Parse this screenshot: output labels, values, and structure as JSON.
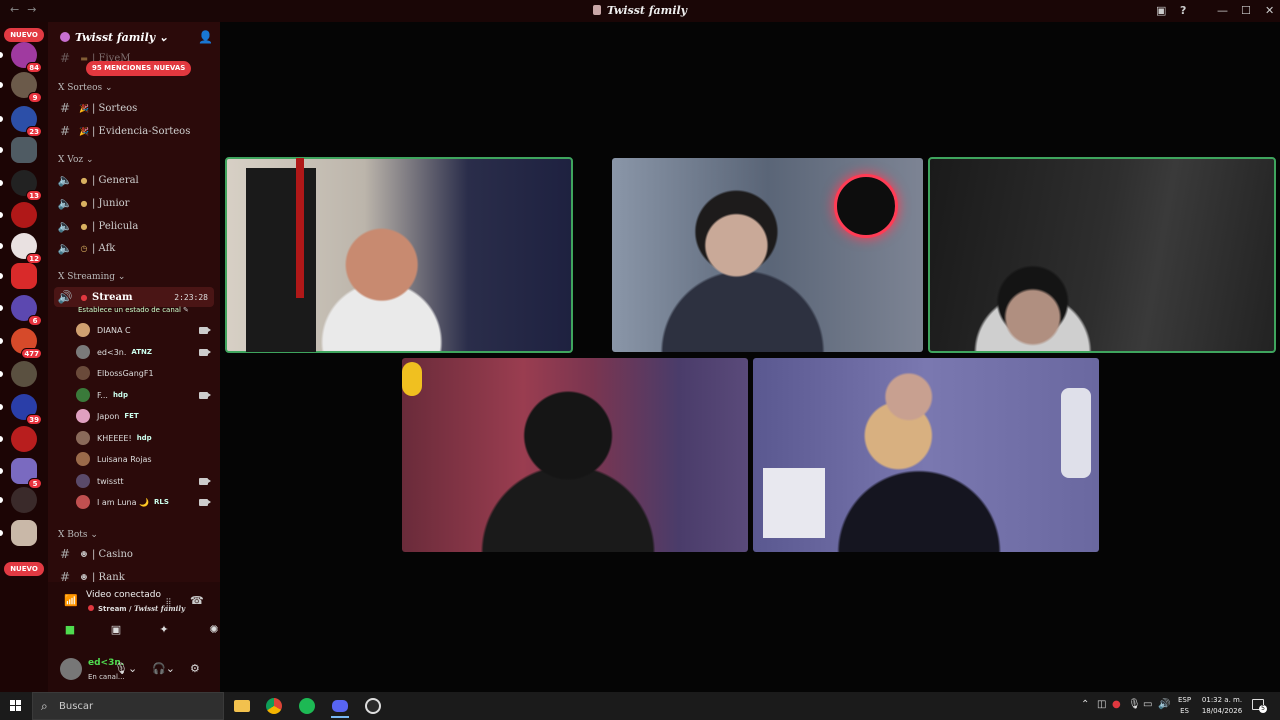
{
  "window": {
    "title": "Twisst family",
    "nav_back": "←",
    "nav_forward": "→"
  },
  "rail": {
    "nuevo_top": "NUEVO",
    "nuevo_bottom": "NUEVO",
    "servers": [
      {
        "badge": "84",
        "color": "#a03aa0"
      },
      {
        "badge": "9",
        "color": "#6b5a4a"
      },
      {
        "badge": "23",
        "color": "#2c4fa8"
      },
      {
        "badge": "",
        "color": "#4f5b63"
      },
      {
        "badge": "13",
        "color": "#222222"
      },
      {
        "badge": "",
        "color": "#b01818"
      },
      {
        "badge": "12",
        "color": "#e9e1e1"
      },
      {
        "badge": "",
        "color": "#d92a2a"
      },
      {
        "badge": "6",
        "color": "#5c48b0"
      },
      {
        "badge": "477",
        "color": "#d64a2a"
      },
      {
        "badge": "",
        "color": "#5a5040"
      },
      {
        "badge": "39",
        "color": "#2a3ea8"
      },
      {
        "badge": "",
        "color": "#b81e1e"
      },
      {
        "badge": "5",
        "color": "#7a6ac0"
      },
      {
        "badge": "",
        "color": "#3a2a2a"
      },
      {
        "badge": "",
        "color": "#c9b8a8"
      }
    ]
  },
  "sidebar": {
    "server_name": "Twisst family",
    "mentions_pill": "95 MENCIONES NUEVAS",
    "partial_channel": "| FiveM",
    "categories": {
      "sorteos": "X Sorteos",
      "voz": "X Voz",
      "streaming": "X Streaming",
      "bots": "X Bots"
    },
    "text_channels": {
      "sorteos": "| Sorteos",
      "evidencia": "| Evidencia-Sorteos",
      "casino": "| Casino",
      "rank": "| Rank"
    },
    "voice_channels": {
      "general": "| General",
      "junior": "| Junior",
      "pelicula": "| Pelicula",
      "afk": "| Afk"
    },
    "stream": {
      "name": "Stream",
      "timer": "2:23:28",
      "status_hint": "Establece un estado de canal"
    },
    "voice_users": [
      {
        "name": "DIANA C",
        "tag": "",
        "camera": true,
        "color": "#d0a070"
      },
      {
        "name": "ed<3n.",
        "tag": "ATNZ",
        "camera": true,
        "color": "#7a7a7a"
      },
      {
        "name": "ElbossGangF1",
        "tag": "",
        "camera": false,
        "color": "#6a4a3a"
      },
      {
        "name": "F...",
        "tag": "hdp",
        "camera": true,
        "color": "#3a7a3a"
      },
      {
        "name": "Japon",
        "tag": "FET",
        "camera": false,
        "color": "#e0a0c0"
      },
      {
        "name": "KHEEEE!",
        "tag": "hdp",
        "camera": false,
        "color": "#8a6a5a"
      },
      {
        "name": "Luisana Rojas",
        "tag": "",
        "camera": false,
        "color": "#9a6a4a"
      },
      {
        "name": "twisstt",
        "tag": "",
        "camera": true,
        "color": "#5a4a6a"
      },
      {
        "name": "I am Luna 🌙",
        "tag": "RLS",
        "camera": true,
        "color": "#c05050"
      }
    ]
  },
  "voice_panel": {
    "status": "Video conectado",
    "channel": "Stream",
    "server": "Twisst family",
    "separator": " / "
  },
  "user_bar": {
    "username": "ed<3n.",
    "status": "En canal..."
  },
  "taskbar": {
    "search_placeholder": "Buscar",
    "lang_top": "ESP",
    "lang_bottom": "ES",
    "time": "01:32 a. m.",
    "date": "18/04/2026",
    "notifications": "5"
  }
}
